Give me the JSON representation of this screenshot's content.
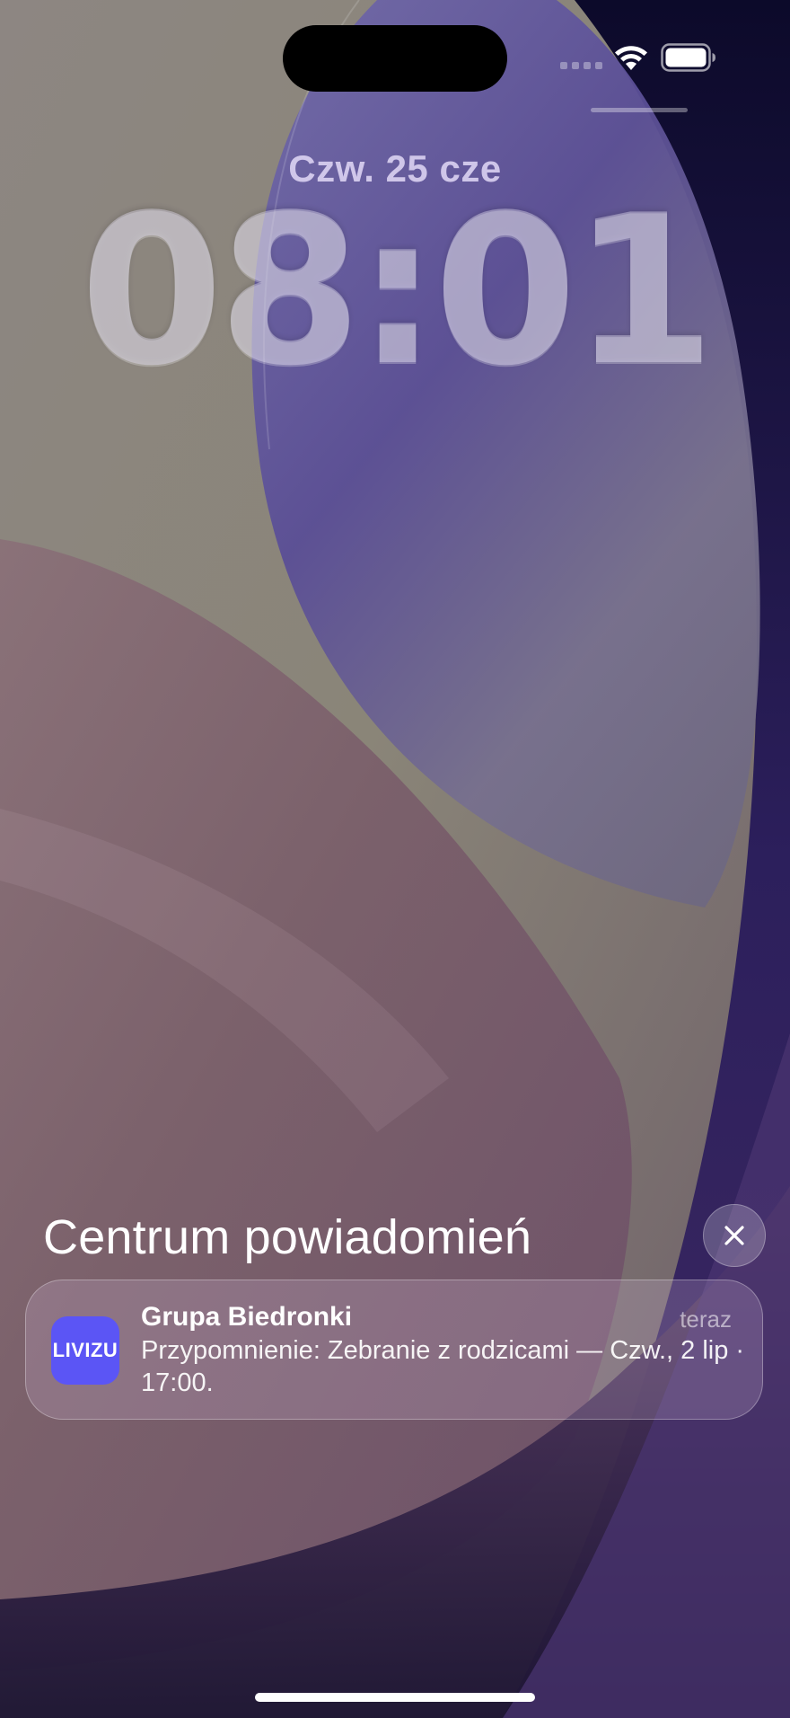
{
  "lock_screen": {
    "date": "Czw. 25 cze",
    "time": "08:01"
  },
  "status_bar": {
    "icons": [
      "signal-icon",
      "wifi-icon",
      "battery-icon"
    ]
  },
  "notification_center": {
    "title": "Centrum powiadomień",
    "clear_icon": "close-icon",
    "notifications": [
      {
        "app_icon_text": "LIVIZU",
        "sender": "Grupa Biedronki",
        "time": "teraz",
        "body": "Przypomnienie: Zebranie z rodzicami — Czw., 2 lip · 17:00."
      }
    ]
  },
  "colors": {
    "app_icon": "#5b55f5",
    "wallpaper_purple": "#3b2a6e",
    "wallpaper_olive": "#9a9480"
  }
}
